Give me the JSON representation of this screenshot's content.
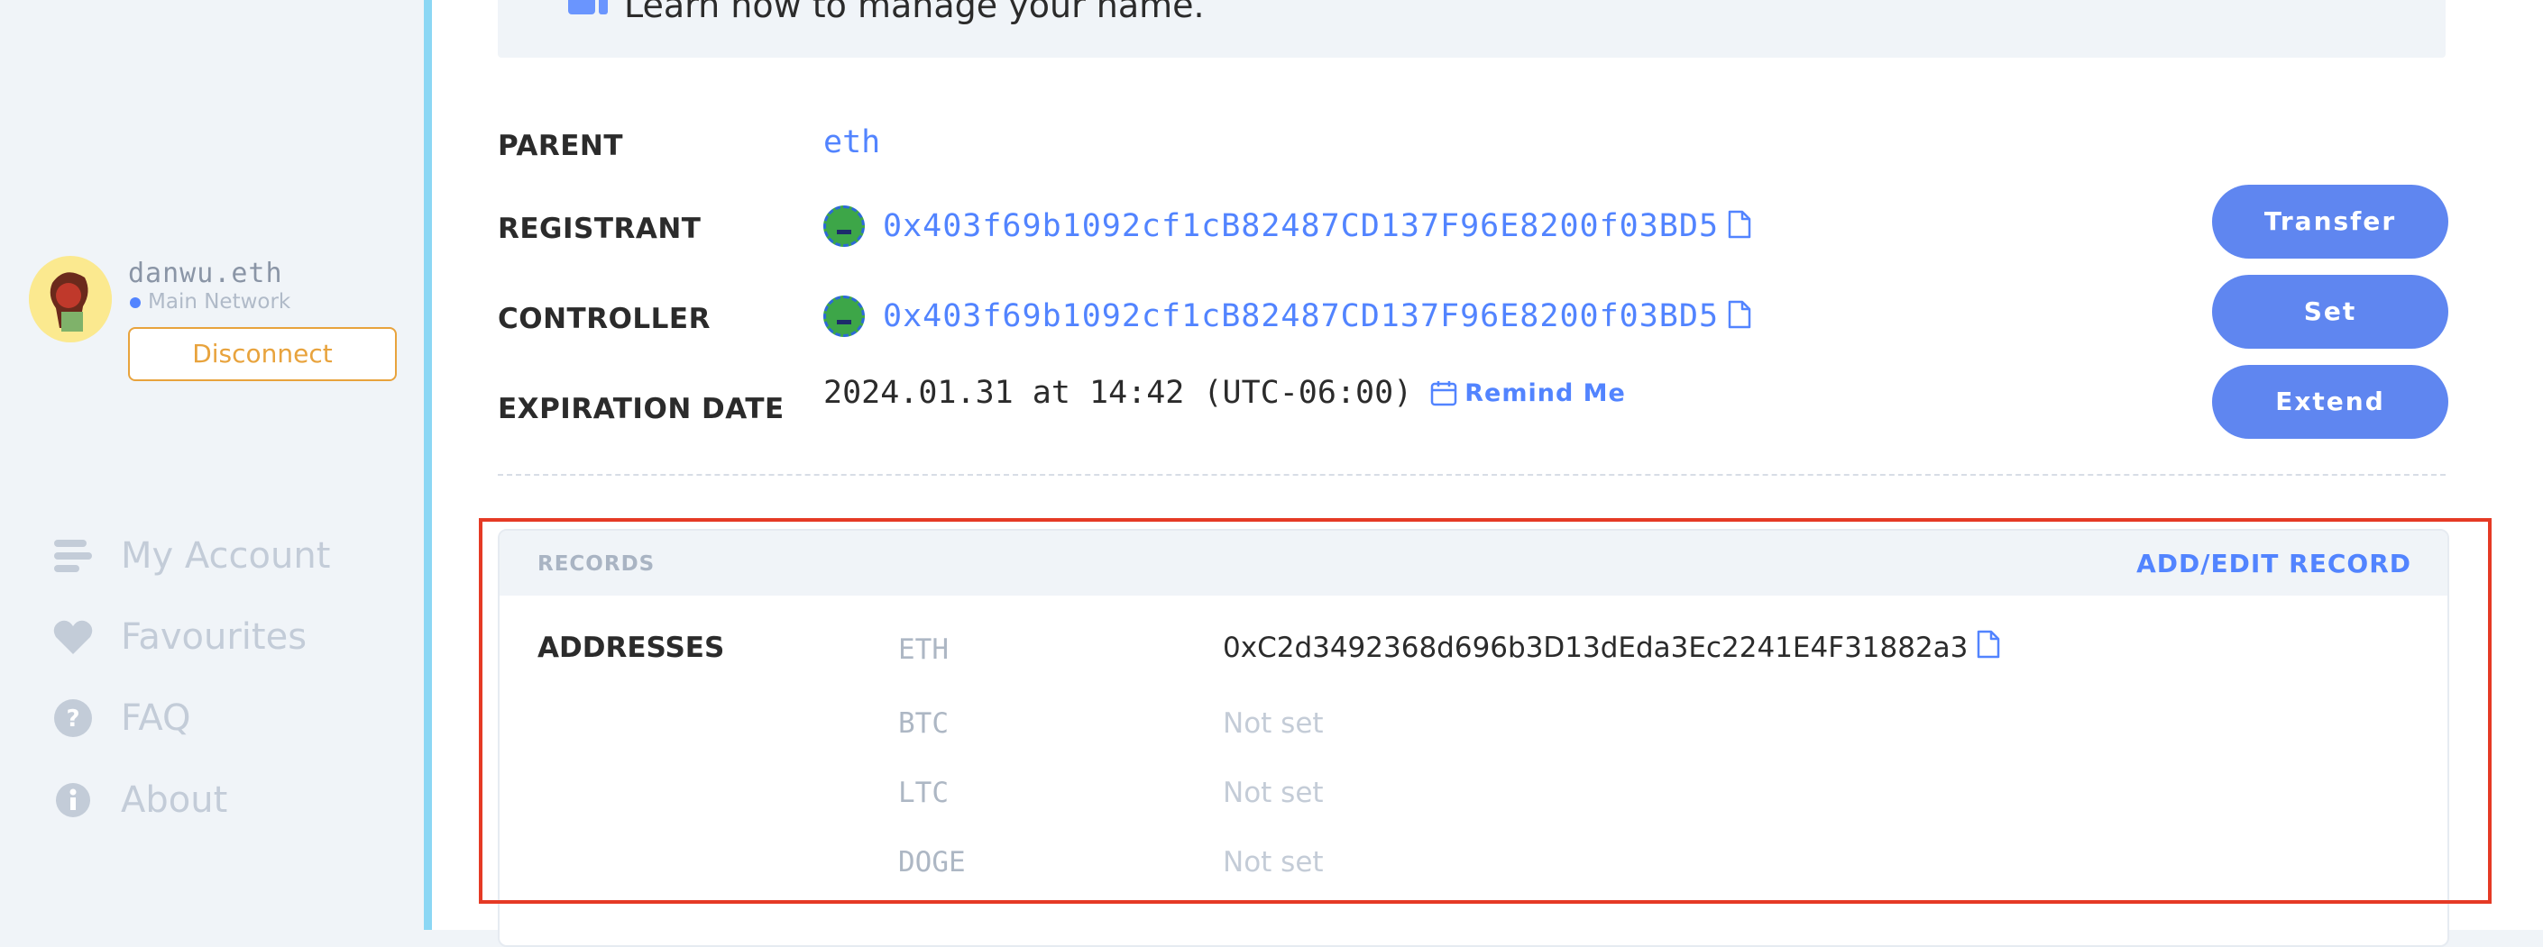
{
  "user": {
    "name": "danwu.eth",
    "network": "Main Network",
    "disconnect_label": "Disconnect"
  },
  "nav": {
    "items": [
      {
        "label": "My Account",
        "icon": "list-icon"
      },
      {
        "label": "Favourites",
        "icon": "heart-icon"
      },
      {
        "label": "FAQ",
        "icon": "question-icon"
      },
      {
        "label": "About",
        "icon": "info-icon"
      }
    ]
  },
  "banner": {
    "text": "Learn how to manage your name."
  },
  "details": {
    "parent_label": "PARENT",
    "parent_value": "eth",
    "registrant_label": "REGISTRANT",
    "registrant_value": "0x403f69b1092cf1cB82487CD137F96E8200f03BD5",
    "controller_label": "CONTROLLER",
    "controller_value": "0x403f69b1092cf1cB82487CD137F96E8200f03BD5",
    "expiration_label": "EXPIRATION DATE",
    "expiration_value": "2024.01.31 at 14:42 (UTC-06:00)",
    "remind_label": "Remind Me"
  },
  "actions": {
    "transfer_label": "Transfer",
    "set_label": "Set",
    "extend_label": "Extend"
  },
  "records": {
    "title": "RECORDS",
    "add_edit_label": "ADD/EDIT RECORD",
    "addresses_label": "ADDRESSES",
    "items": [
      {
        "coin": "ETH",
        "value": "0xC2d3492368d696b3D13dEda3Ec2241E4F31882a3"
      },
      {
        "coin": "BTC",
        "value": "Not set"
      },
      {
        "coin": "LTC",
        "value": "Not set"
      },
      {
        "coin": "DOGE",
        "value": "Not set"
      }
    ]
  },
  "colors": {
    "accent": "#5284ff",
    "button": "#5f86f0",
    "disconnect": "#e8a33d",
    "highlight": "#e53a25",
    "sidebar_bar": "#8cd7f4"
  }
}
